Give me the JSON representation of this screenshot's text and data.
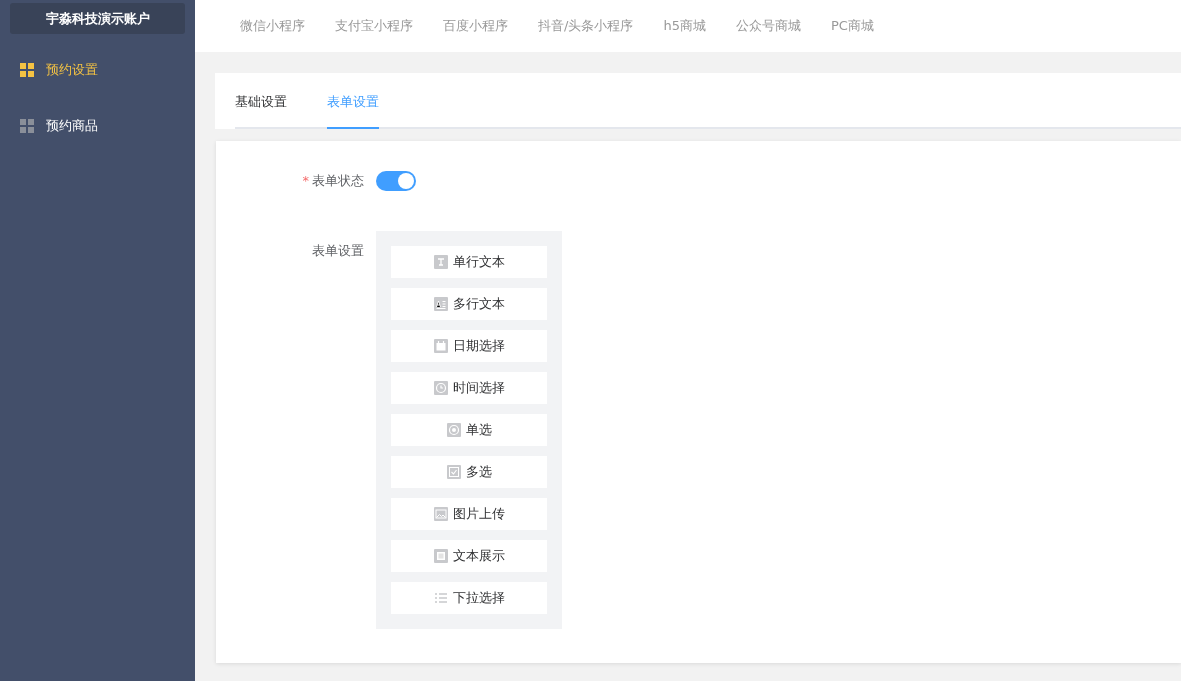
{
  "sidebar": {
    "account": "宇淼科技演示账户",
    "items": [
      {
        "label": "预约设置",
        "selected": true
      },
      {
        "label": "预约商品",
        "selected": false
      }
    ]
  },
  "top_nav": [
    "微信小程序",
    "支付宝小程序",
    "百度小程序",
    "抖音/头条小程序",
    "h5商城",
    "公众号商城",
    "PC商城"
  ],
  "tabs": [
    {
      "label": "基础设置",
      "selected": false
    },
    {
      "label": "表单设置",
      "selected": true
    }
  ],
  "form": {
    "status": {
      "label": "表单状态",
      "required_mark": "*",
      "on": true
    },
    "fields_label": "表单设置",
    "fields": [
      {
        "kind": "text",
        "label": "单行文本"
      },
      {
        "kind": "textarea",
        "label": "多行文本"
      },
      {
        "kind": "date",
        "label": "日期选择"
      },
      {
        "kind": "time",
        "label": "时间选择"
      },
      {
        "kind": "radio",
        "label": "单选"
      },
      {
        "kind": "checkbox",
        "label": "多选"
      },
      {
        "kind": "image",
        "label": "图片上传"
      },
      {
        "kind": "display",
        "label": "文本展示"
      },
      {
        "kind": "select",
        "label": "下拉选择"
      }
    ]
  }
}
